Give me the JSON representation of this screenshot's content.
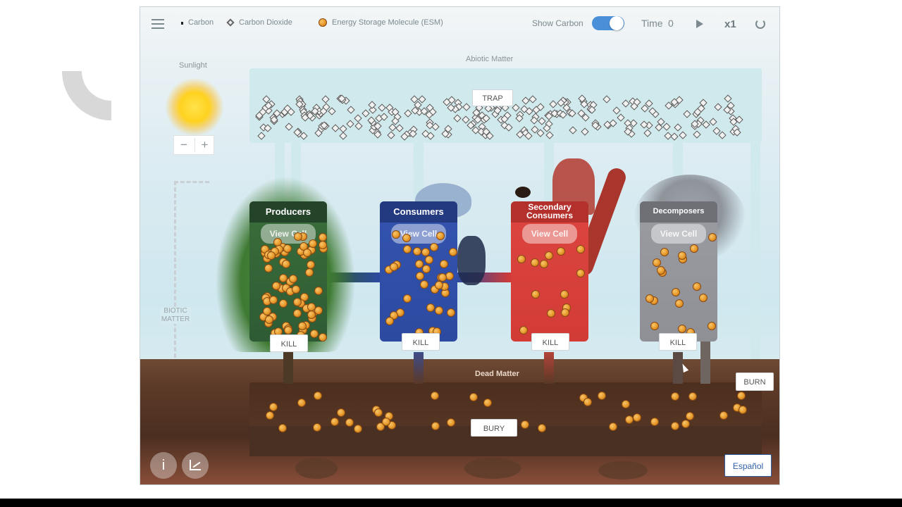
{
  "toolbar": {
    "legend_carbon": "Carbon",
    "legend_co2": "Carbon Dioxide",
    "legend_esm": "Energy Storage Molecule (ESM)",
    "show_carbon_label": "Show Carbon",
    "show_carbon_on": true,
    "time_label": "Time",
    "time_value": "0",
    "speed": "x1"
  },
  "sunlight": {
    "label": "Sunlight",
    "minus": "−",
    "plus": "+"
  },
  "abiotic": {
    "label": "Abiotic Matter",
    "trap": "TRAP"
  },
  "biotic": {
    "label_line1": "BIOTIC",
    "label_line2": "MATTER"
  },
  "chambers": [
    {
      "title": "Producers",
      "view_cell": "View Cell",
      "kill": "KILL",
      "color": "#2e5b34"
    },
    {
      "title": "Consumers",
      "view_cell": "View Cell",
      "kill": "KILL",
      "color": "#2c4aa0"
    },
    {
      "title_line1": "Secondary",
      "title_line2": "Consumers",
      "view_cell": "View Cell",
      "kill": "KILL",
      "color": "#d23b36"
    },
    {
      "title": "Decomposers",
      "view_cell": "View Cell",
      "kill": "KILL",
      "color": "#8e9096"
    }
  ],
  "dead_matter": {
    "label": "Dead Matter",
    "bury": "BURY",
    "burn": "BURN"
  },
  "footer": {
    "info_icon": "i",
    "language": "Español"
  },
  "colors": {
    "accent_toggle": "#4a90d9",
    "producers": "#2e5b34",
    "consumers": "#2c4aa0",
    "secondary": "#d23b36",
    "decomposers": "#8e9096"
  }
}
